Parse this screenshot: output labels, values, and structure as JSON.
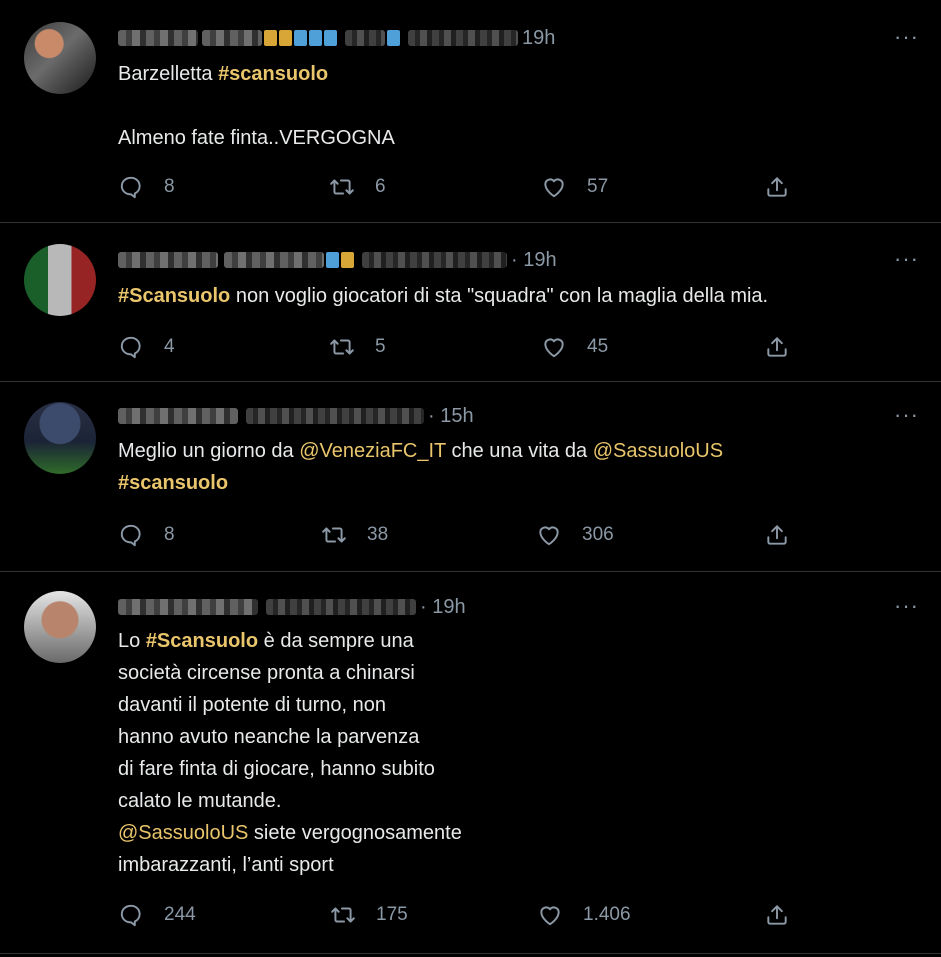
{
  "tweets": [
    {
      "time": "19h",
      "body": [
        {
          "type": "text",
          "text": "Barzelletta "
        },
        {
          "type": "hashtag",
          "text": "#scansuolo"
        },
        {
          "type": "text",
          "text": "\n\nAlmeno fate finta..VERGOGNA"
        }
      ],
      "replies": "8",
      "retweets": "6",
      "likes": "57"
    },
    {
      "time": "· 19h",
      "body": [
        {
          "type": "hashtag",
          "text": "#Scansuolo"
        },
        {
          "type": "text",
          "text": " non voglio giocatori di sta \"squadra\" con la maglia della mia."
        }
      ],
      "replies": "4",
      "retweets": "5",
      "likes": "45"
    },
    {
      "time": "· 15h",
      "body": [
        {
          "type": "text",
          "text": "Meglio un giorno da "
        },
        {
          "type": "mention",
          "text": "@VeneziaFC_IT"
        },
        {
          "type": "text",
          "text": " che una vita da "
        },
        {
          "type": "mention",
          "text": "@SassuoloUS"
        },
        {
          "type": "text",
          "text": "\n"
        },
        {
          "type": "hashtag",
          "text": "#scansuolo"
        }
      ],
      "replies": "8",
      "retweets": "38",
      "likes": "306"
    },
    {
      "time": "· 19h",
      "body": [
        {
          "type": "text",
          "text": "Lo "
        },
        {
          "type": "hashtag",
          "text": "#Scansuolo"
        },
        {
          "type": "text",
          "text": " è da sempre una\nsocietà circense pronta a chinarsi\ndavanti il potente di turno, non\nhanno avuto neanche la parvenza\ndi fare finta di giocare, hanno subito\ncalato le mutande.\n"
        },
        {
          "type": "mention",
          "text": "@SassuoloUS"
        },
        {
          "type": "text",
          "text": " siete vergognosamente\nimbarazzanti, l’anti sport"
        }
      ],
      "replies": "244",
      "retweets": "175",
      "likes": "1.406"
    }
  ],
  "more_label": "···",
  "colors": {
    "background": "#000000",
    "text": "#e7e9ea",
    "muted": "#8b98a5",
    "accent": "#e9c56b",
    "divider": "#2f3336"
  },
  "icons": {
    "reply": "reply-icon",
    "retweet": "retweet-icon",
    "like": "like-icon",
    "share": "share-icon",
    "more": "more-icon"
  }
}
